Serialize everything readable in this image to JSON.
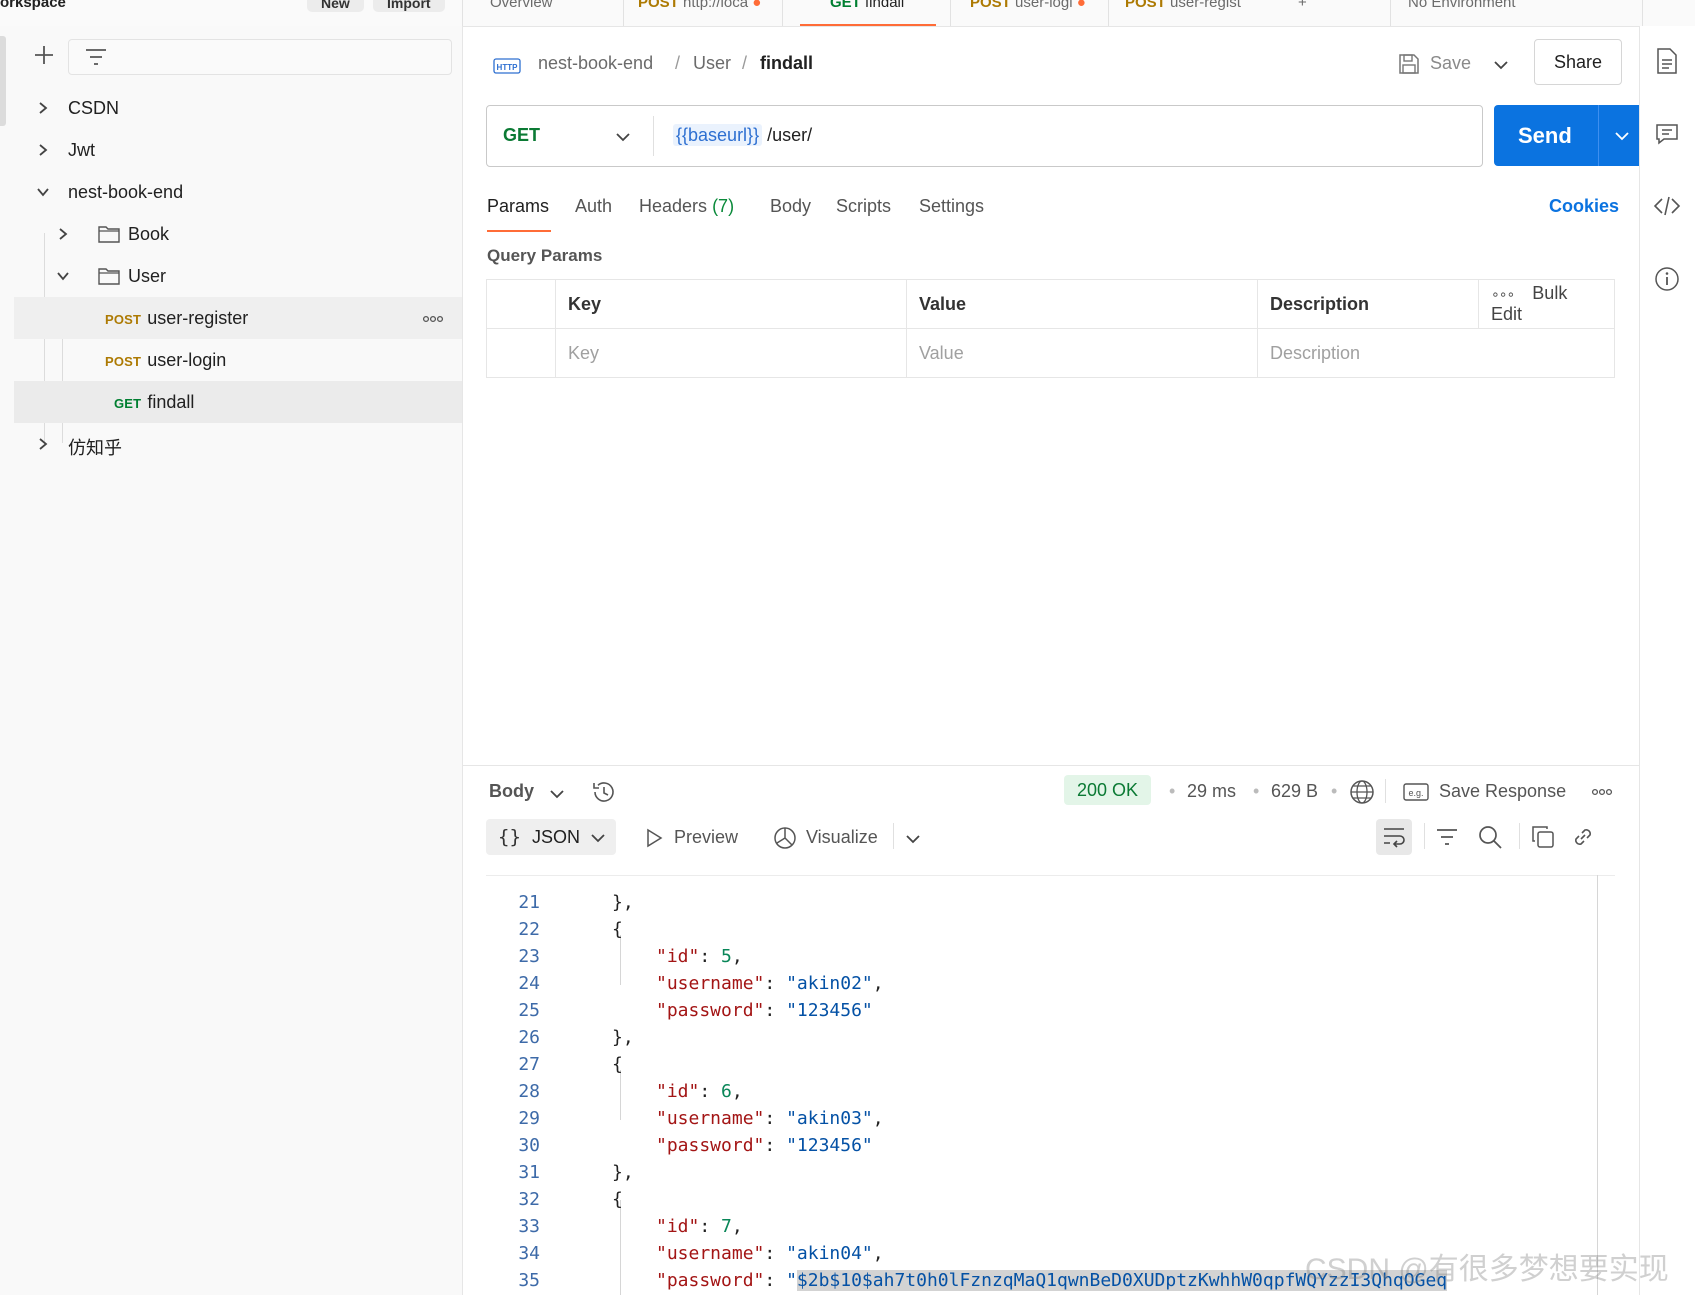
{
  "top_tabs": {
    "workspace_label": "orkspace",
    "new_label": "New",
    "import_label": "Import",
    "overview_label": "Overview",
    "tab2_method": "POST",
    "tab2_label": "http://loca",
    "tab3_method": "GET",
    "tab3_label": "findall",
    "tab4_method": "POST",
    "tab4_label": "user-logi",
    "tab5_method": "POST",
    "tab5_label": "user-regist",
    "env_label": "No Environment"
  },
  "sidebar": {
    "items": [
      {
        "label": "CSDN"
      },
      {
        "label": "Jwt"
      },
      {
        "label": "nest-book-end"
      },
      {
        "label": "Book"
      },
      {
        "label": "User"
      },
      {
        "method": "POST",
        "label": "user-register"
      },
      {
        "method": "POST",
        "label": "user-login"
      },
      {
        "method": "GET",
        "label": "findall"
      },
      {
        "label": "仿知乎"
      }
    ]
  },
  "breadcrumb": {
    "icon_text": "HTTP",
    "part1": "nest-book-end",
    "sep": "/",
    "part2": "User",
    "current": "findall"
  },
  "toolbar": {
    "save_label": "Save",
    "share_label": "Share"
  },
  "request": {
    "method": "GET",
    "url_variable": "{{baseurl}}",
    "url_path": " /user/",
    "send_label": "Send"
  },
  "request_tabs": {
    "params": "Params",
    "auth": "Auth",
    "headers": "Headers",
    "headers_count": "(7)",
    "body": "Body",
    "scripts": "Scripts",
    "settings": "Settings",
    "cookies": "Cookies"
  },
  "query_params": {
    "title": "Query Params",
    "headers": {
      "key": "Key",
      "value": "Value",
      "description": "Description",
      "bulk_edit": "Bulk Edit"
    },
    "placeholders": {
      "key": "Key",
      "value": "Value",
      "description": "Description"
    }
  },
  "response": {
    "body_label": "Body",
    "status": "200 OK",
    "time": "29 ms",
    "size": "629 B",
    "save_response_label": "Save Response",
    "format": "JSON",
    "preview_label": "Preview",
    "visualize_label": "Visualize",
    "lines": [
      {
        "n": "21",
        "text": "},"
      },
      {
        "n": "22",
        "text": "{"
      },
      {
        "n": "23",
        "key": "\"id\"",
        "num": "5"
      },
      {
        "n": "24",
        "key": "\"username\"",
        "str": "\"akin02\"",
        "comma": ","
      },
      {
        "n": "25",
        "key": "\"password\"",
        "str": "\"123456\"",
        "comma": ""
      },
      {
        "n": "26",
        "text": "},"
      },
      {
        "n": "27",
        "text": "{"
      },
      {
        "n": "28",
        "key": "\"id\"",
        "num": "6"
      },
      {
        "n": "29",
        "key": "\"username\"",
        "str": "\"akin03\"",
        "comma": ","
      },
      {
        "n": "30",
        "key": "\"password\"",
        "str": "\"123456\"",
        "comma": ""
      },
      {
        "n": "31",
        "text": "},"
      },
      {
        "n": "32",
        "text": "{"
      },
      {
        "n": "33",
        "key": "\"id\"",
        "num": "7"
      },
      {
        "n": "34",
        "key": "\"username\"",
        "str": "\"akin04\"",
        "comma": ","
      },
      {
        "n": "35",
        "key": "\"password\"",
        "str_hl": "$2b$10$ah7t0h0lFznzqMaQ1qwnBeD0XUDptzKwhhW0qpfWQYzzI3QhqOGeq",
        "quote": "\""
      }
    ]
  },
  "watermark": "CSDN @有很多梦想要实现"
}
